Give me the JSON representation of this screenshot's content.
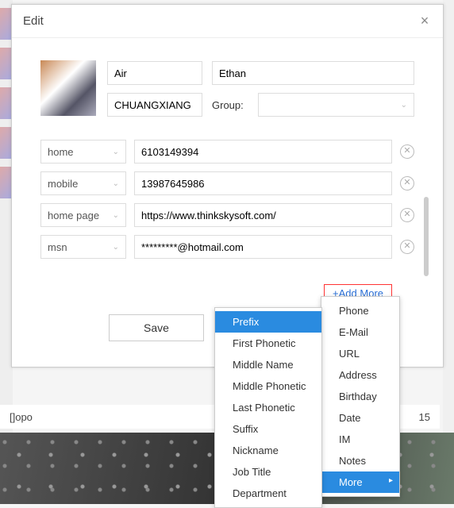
{
  "dialog": {
    "title": "Edit",
    "name_first_field": "Air",
    "name_last_field": "Ethan",
    "company_field": "CHUANGXIANG",
    "group_label": "Group:",
    "save_label": "Save",
    "add_more_label": "+Add More"
  },
  "fields": [
    {
      "type": "home",
      "value": "6103149394"
    },
    {
      "type": "mobile",
      "value": "13987645986"
    },
    {
      "type": "home page",
      "value": "https://www.thinkskysoft.com/"
    },
    {
      "type": "msn",
      "value": "*********@hotmail.com"
    }
  ],
  "menu_outer": [
    "Phone",
    "E-Mail",
    "URL",
    "Address",
    "Birthday",
    "Date",
    "IM",
    "Notes",
    "More"
  ],
  "menu_inner": [
    "Prefix",
    "First Phonetic",
    "Middle Name",
    "Middle Phonetic",
    "Last Phonetic",
    "Suffix",
    "Nickname",
    "Job Title",
    "Department"
  ],
  "menu_outer_highlight": "More",
  "menu_inner_highlight": "Prefix",
  "list_row": {
    "name": "[]opo",
    "right": "15"
  }
}
